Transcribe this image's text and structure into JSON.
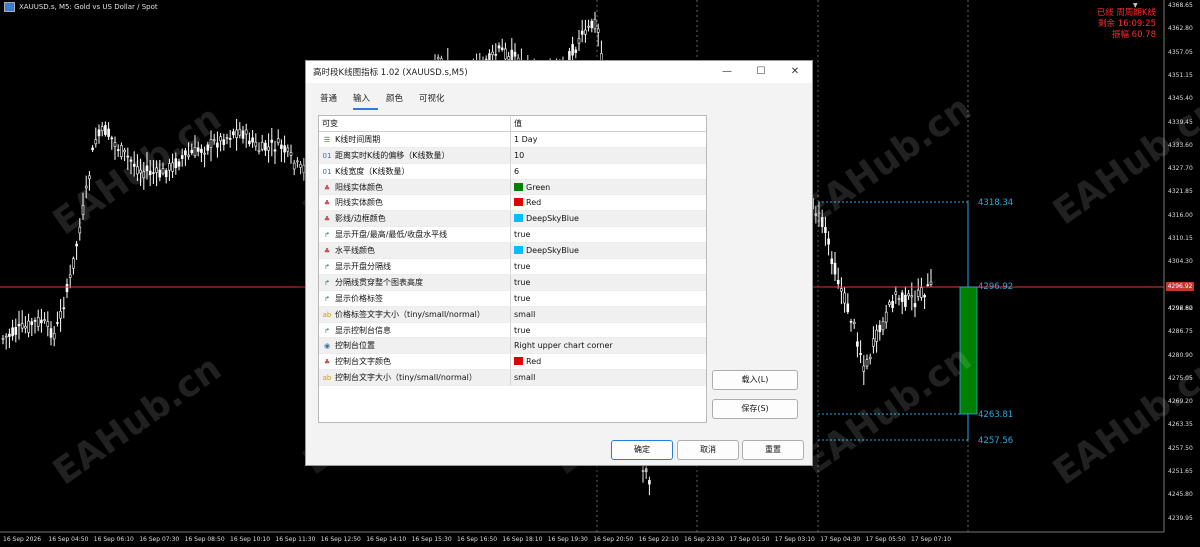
{
  "window": {
    "title": "XAUUSD.s, M5:  Gold vs US Dollar / Spot"
  },
  "panel": {
    "lines": [
      "已线 周周期K线",
      "剩余 16:09:25",
      "振幅 60.78"
    ]
  },
  "price_axis": [
    "4368.65",
    "4362.80",
    "4357.05",
    "4351.15",
    "4345.40",
    "4339.45",
    "4333.60",
    "4327.70",
    "4321.85",
    "4316.00",
    "4310.15",
    "4304.30",
    "4298.45",
    "4296.82",
    "4292.60",
    "4286.75",
    "4280.90",
    "4275.05",
    "4269.20",
    "4263.35",
    "4257.50",
    "4251.65",
    "4245.80",
    "4239.95"
  ],
  "time_axis": [
    "16 Sep 2026",
    "16 Sep 04:50",
    "16 Sep 06:10",
    "16 Sep 07:30",
    "16 Sep 08:50",
    "16 Sep 10:10",
    "16 Sep 11:30",
    "16 Sep 12:50",
    "16 Sep 14:10",
    "16 Sep 15:30",
    "16 Sep 16:50",
    "16 Sep 18:10",
    "16 Sep 19:30",
    "16 Sep 20:50",
    "16 Sep 22:10",
    "16 Sep 23:30",
    "17 Sep 01:50",
    "17 Sep 03:10",
    "17 Sep 04:30",
    "17 Sep 05:50",
    "17 Sep 07:10"
  ],
  "levels": {
    "high": "4318.34",
    "open": "4296.92",
    "close": "4263.81",
    "low": "4257.56"
  },
  "current_price_tag": "4296.92",
  "watermark": "EAHub.cn",
  "colors": {
    "background": "#000000",
    "candles": "#ffffff",
    "level_lines": "#2aa9e0",
    "price_line": "#e23a3a",
    "bear_body": "#008000",
    "panel_text": "#ff2a2a"
  },
  "dialog": {
    "title": "高时段K线图指标 1.02 (XAUUSD.s,M5)",
    "minimize": "—",
    "maximize": "☐",
    "close": "✕",
    "tabs": [
      "普通",
      "输入",
      "颜色",
      "可视化"
    ],
    "active_tab": "输入",
    "header": {
      "variable": "可变",
      "value": "值"
    },
    "params": [
      {
        "icon": "menu-icon",
        "name": "K线时间周期",
        "value": "1 Day"
      },
      {
        "icon": "number-icon",
        "name": "距离实时K线的偏移（K线数量）",
        "value": "10"
      },
      {
        "icon": "number-icon",
        "name": "K线宽度（K线数量）",
        "value": "6"
      },
      {
        "icon": "palette-icon",
        "name": "阳线实体颜色",
        "value": "Green",
        "swatch": "#008000"
      },
      {
        "icon": "palette-icon",
        "name": "阴线实体颜色",
        "value": "Red",
        "swatch": "#e00000"
      },
      {
        "icon": "palette-icon",
        "name": "影线/边框颜色",
        "value": "DeepSkyBlue",
        "swatch": "#00bfff"
      },
      {
        "icon": "toggle-icon",
        "name": "显示开盘/最高/最低/收盘水平线",
        "value": "true"
      },
      {
        "icon": "palette-icon",
        "name": "水平线颜色",
        "value": "DeepSkyBlue",
        "swatch": "#00bfff"
      },
      {
        "icon": "toggle-icon",
        "name": "显示开盘分隔线",
        "value": "true"
      },
      {
        "icon": "toggle-icon",
        "name": "分隔线贯穿整个图表高度",
        "value": "true"
      },
      {
        "icon": "toggle-icon",
        "name": "显示价格标签",
        "value": "true"
      },
      {
        "icon": "text-icon",
        "name": "价格标签文字大小（tiny/small/normal）",
        "value": "small"
      },
      {
        "icon": "toggle-icon",
        "name": "显示控制台信息",
        "value": "true"
      },
      {
        "icon": "list-icon",
        "name": "控制台位置",
        "value": "Right upper chart corner"
      },
      {
        "icon": "palette-icon",
        "name": "控制台文字颜色",
        "value": "Red",
        "swatch": "#e00000"
      },
      {
        "icon": "text-icon",
        "name": "控制台文字大小（tiny/small/normal）",
        "value": "small"
      }
    ],
    "buttons": {
      "load": "载入(L)",
      "save": "保存(S)",
      "ok": "确定",
      "cancel": "取消",
      "reset": "重置"
    }
  }
}
